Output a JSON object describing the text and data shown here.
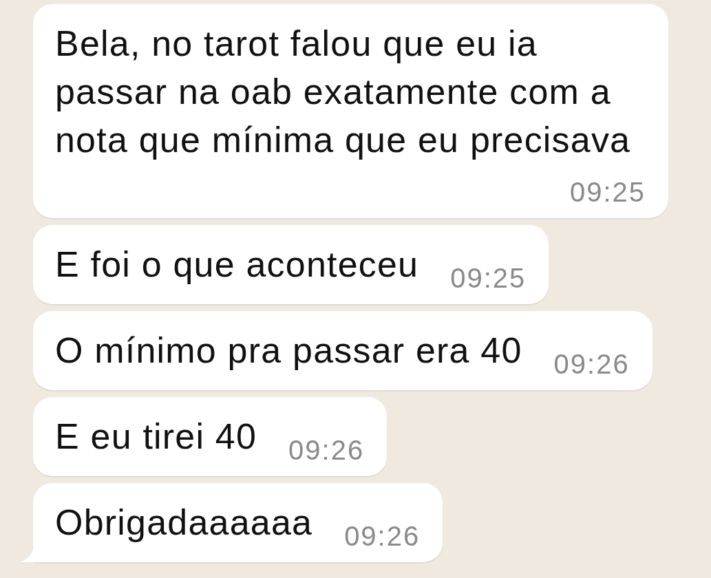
{
  "messages": [
    {
      "text": "Bela, no tarot falou que eu ia passar na oab exatamente com a nota que mínima que eu precisava",
      "time": "09:25",
      "tail": false
    },
    {
      "text": "E foi o que aconteceu",
      "time": "09:25",
      "tail": false
    },
    {
      "text": "O mínimo pra passar era 40",
      "time": "09:26",
      "tail": false
    },
    {
      "text": "E eu tirei 40",
      "time": "09:26",
      "tail": false
    },
    {
      "text": "Obrigadaaaaaa",
      "time": "09:26",
      "tail": true
    }
  ]
}
